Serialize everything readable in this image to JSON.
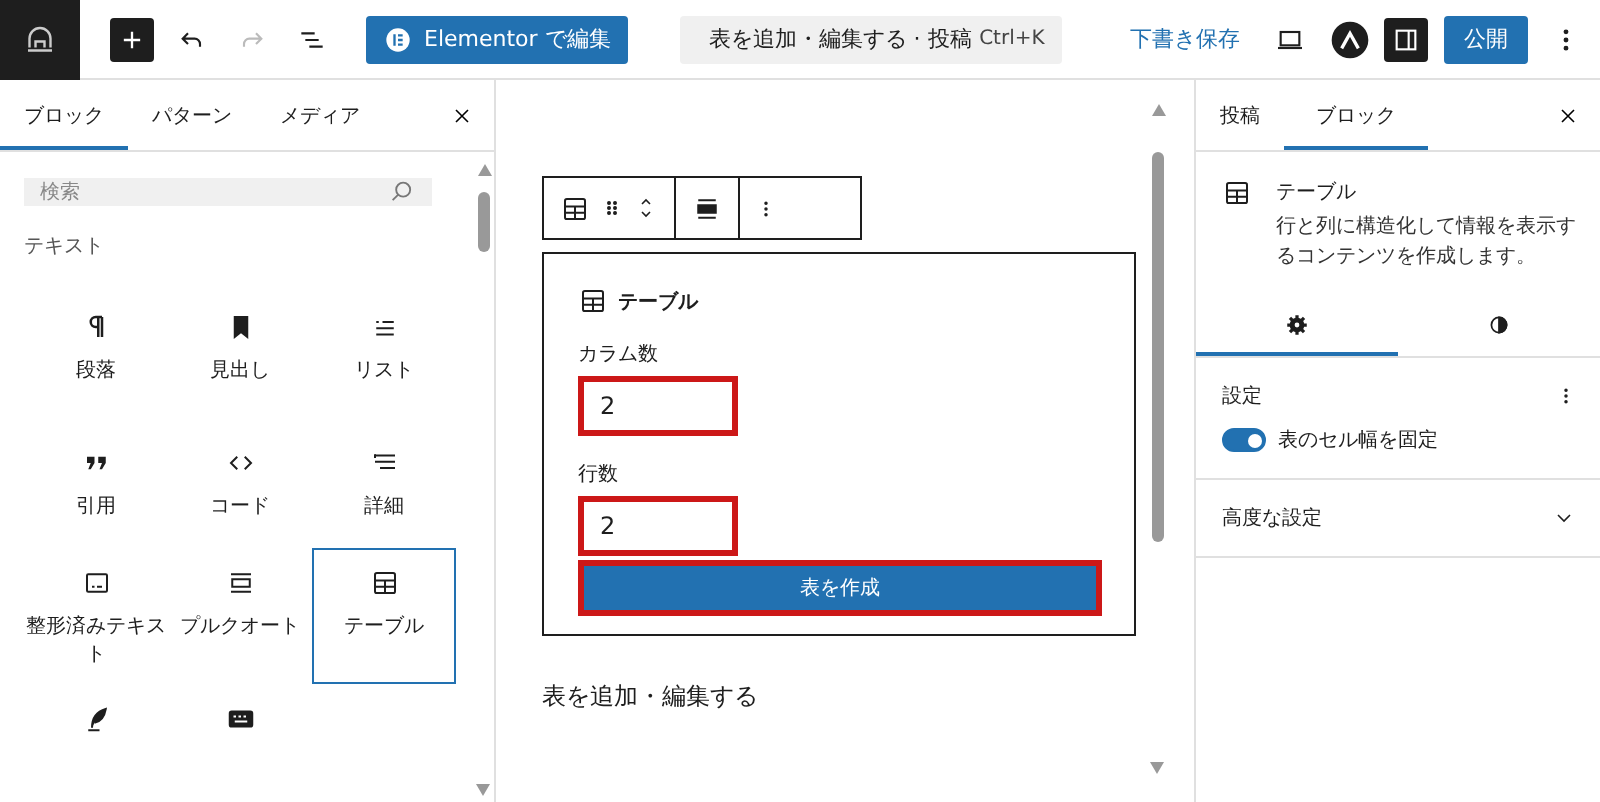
{
  "topbar": {
    "edit_button": "Elementor で編集",
    "command_bar": {
      "title": "表を追加・編集する · 投稿",
      "shortcut": "Ctrl+K"
    },
    "save_draft": "下書き保存",
    "publish": "公開"
  },
  "inserter": {
    "tabs": [
      {
        "label": "ブロック",
        "selected": true
      },
      {
        "label": "パターン",
        "selected": false
      },
      {
        "label": "メディア",
        "selected": false
      }
    ],
    "search": {
      "placeholder": "検索"
    },
    "category": "テキスト",
    "blocks": [
      {
        "kind": "paragraph",
        "label": "段落",
        "selected": false
      },
      {
        "kind": "heading",
        "label": "見出し",
        "selected": false
      },
      {
        "kind": "list",
        "label": "リスト",
        "selected": false
      },
      {
        "kind": "quote",
        "label": "引用",
        "selected": false
      },
      {
        "kind": "code",
        "label": "コード",
        "selected": false
      },
      {
        "kind": "details",
        "label": "詳細",
        "selected": false
      },
      {
        "kind": "preformatted",
        "label": "整形済みテキスト",
        "selected": false
      },
      {
        "kind": "pullquote",
        "label": "プルクオート",
        "selected": false
      },
      {
        "kind": "table",
        "label": "テーブル",
        "selected": true
      },
      {
        "kind": "verse",
        "selected": false
      },
      {
        "kind": "keyboard",
        "selected": false
      }
    ]
  },
  "canvas": {
    "placeholder": {
      "title": "テーブル",
      "fields": [
        {
          "label": "カラム数",
          "value": "2",
          "highlighted": true
        },
        {
          "label": "行数",
          "value": "2",
          "highlighted": true
        }
      ],
      "button": {
        "label": "表を作成",
        "highlighted": true
      }
    },
    "paragraph": "表を追加・編集する"
  },
  "sidebar": {
    "tabs": [
      {
        "label": "投稿",
        "selected": false
      },
      {
        "label": "ブロック",
        "selected": true
      }
    ],
    "block": {
      "name": "テーブル",
      "description": "行と列に構造化して情報を表示するコンテンツを作成します。"
    },
    "subtabs": [
      {
        "kind": "settings",
        "selected": true
      },
      {
        "kind": "styles",
        "selected": false
      }
    ],
    "settings": {
      "title": "設定",
      "toggle": {
        "label": "表のセル幅を固定",
        "on": true
      }
    },
    "advanced": {
      "title": "高度な設定",
      "expanded": false
    }
  }
}
